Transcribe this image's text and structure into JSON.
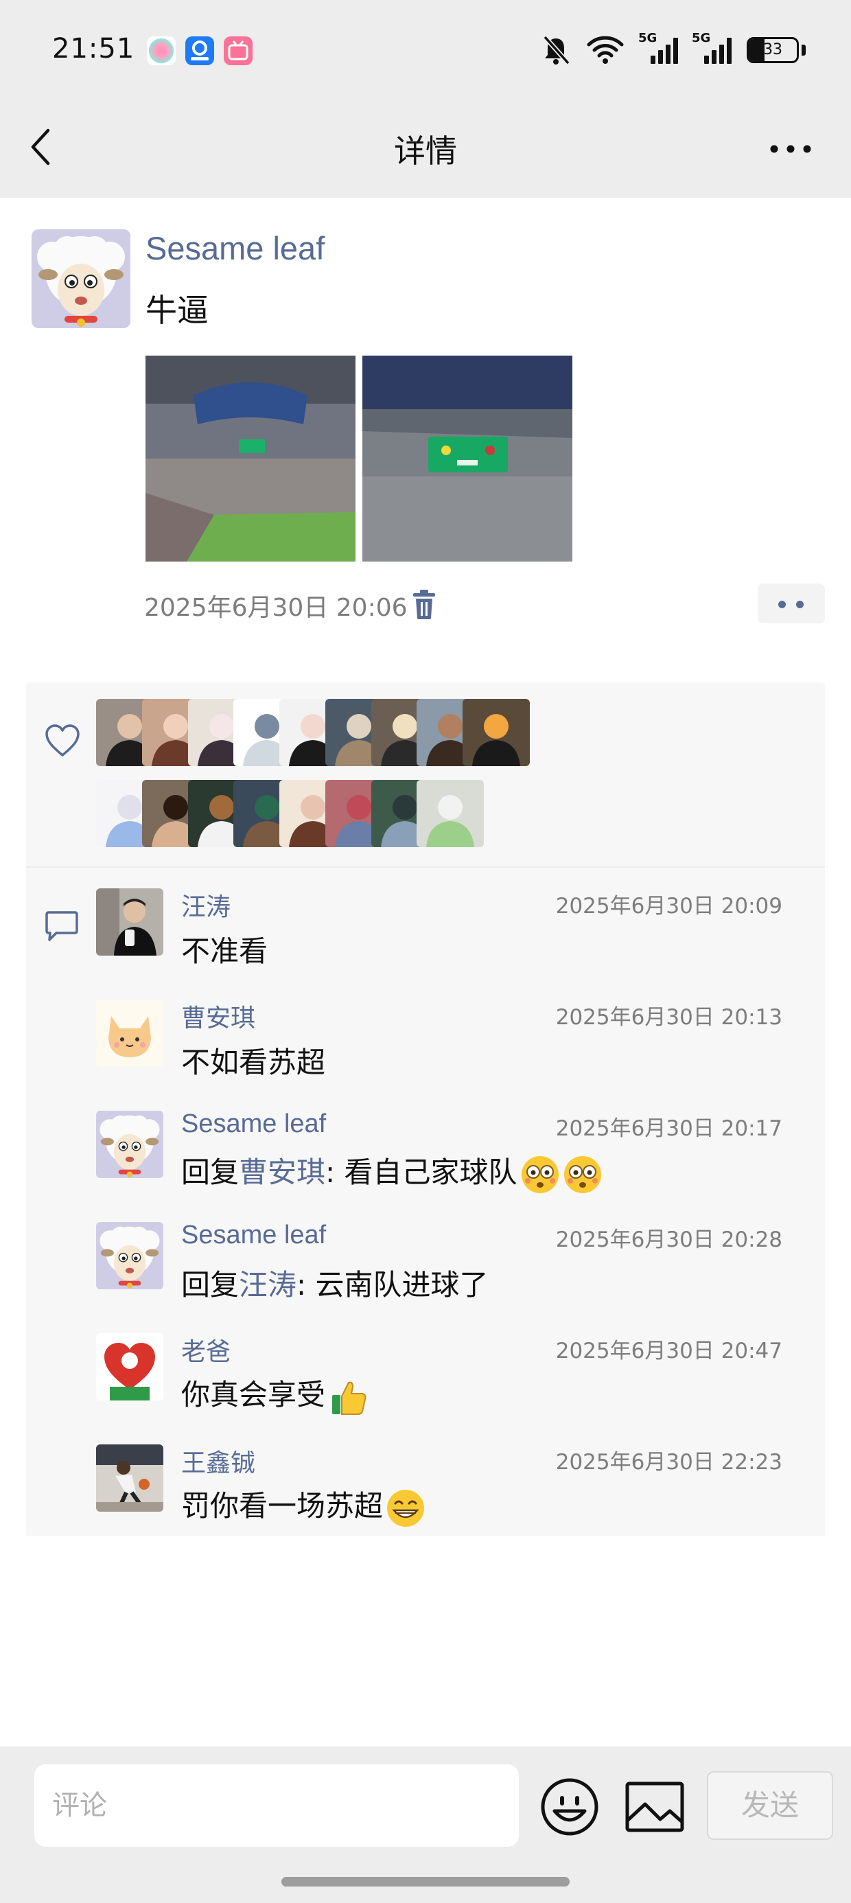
{
  "status_bar": {
    "time": "21:51",
    "signal_1_label": "5G",
    "signal_2_label": "5G",
    "battery_level": "33",
    "icons": [
      "app-icon-1",
      "app-icon-2",
      "bilibili-icon",
      "mute-bell-icon",
      "wifi-icon",
      "signal-icon",
      "signal-icon",
      "battery-icon"
    ]
  },
  "nav": {
    "title": "详情",
    "back_icon": "chevron-left-icon",
    "more_icon": "more-dots-icon"
  },
  "post": {
    "author": "Sesame leaf",
    "text": "牛逼",
    "timestamp": "2025年6月30日 20:06",
    "image_count": 2,
    "delete_icon": "trash-icon",
    "action_icon": "two-dots-icon"
  },
  "likes": {
    "icon": "heart-icon",
    "count": 17
  },
  "comments": [
    {
      "author": "汪涛",
      "time": "2025年6月30日 20:09",
      "parts": [
        {
          "text": "不准看",
          "mention": false
        }
      ],
      "emoji": []
    },
    {
      "author": "曹安琪",
      "time": "2025年6月30日 20:13",
      "parts": [
        {
          "text": "不如看苏超",
          "mention": false
        }
      ],
      "emoji": []
    },
    {
      "author": "Sesame leaf",
      "time": "2025年6月30日 20:17",
      "parts": [
        {
          "text": "回复",
          "mention": false
        },
        {
          "text": "曹安琪",
          "mention": true
        },
        {
          "text": ": 看自己家球队",
          "mention": false
        }
      ],
      "emoji": [
        "flushed-emoji",
        "flushed-emoji"
      ]
    },
    {
      "author": "Sesame leaf",
      "time": "2025年6月30日 20:28",
      "parts": [
        {
          "text": "回复",
          "mention": false
        },
        {
          "text": "汪涛",
          "mention": true
        },
        {
          "text": ": 云南队进球了",
          "mention": false
        }
      ],
      "emoji": []
    },
    {
      "author": "老爸",
      "time": "2025年6月30日 20:47",
      "parts": [
        {
          "text": "你真会享受",
          "mention": false
        }
      ],
      "emoji": [
        "thumbs-up-emoji"
      ]
    },
    {
      "author": "王鑫铖",
      "time": "2025年6月30日 22:23",
      "parts": [
        {
          "text": "罚你看一场苏超",
          "mention": false
        }
      ],
      "emoji": [
        "grin-emoji"
      ]
    }
  ],
  "input": {
    "placeholder": "评论",
    "send_label": "发送",
    "emoji_icon": "smiley-icon",
    "image_icon": "image-icon"
  },
  "colors": {
    "link_blue": "#576b95",
    "bar_gray": "#ededed",
    "block_gray": "#f7f7f7"
  }
}
